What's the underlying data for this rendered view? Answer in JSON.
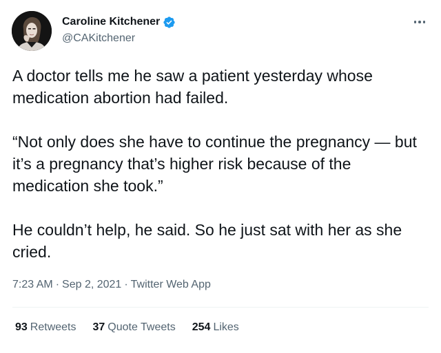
{
  "author": {
    "name": "Caroline Kitchener",
    "handle": "@CAKitchener",
    "verified": true,
    "verified_color": "#1d9bf0"
  },
  "icons": {
    "verified": "verified-badge-icon",
    "more": "more-options-icon",
    "avatar": "profile-photo"
  },
  "tweet": {
    "paragraph_1": "A doctor tells me he saw a patient yesterday whose medication abortion had failed.",
    "paragraph_2": "“Not only does she have to continue the pregnancy — but it’s a pregnancy that’s higher risk because of the medication she took.”",
    "paragraph_3": "He couldn’t help, he said. So he just sat with her as she cried."
  },
  "meta": {
    "time": "7:23 AM",
    "separator_1": "·",
    "date": "Sep 2, 2021",
    "separator_2": "·",
    "app": "Twitter Web App"
  },
  "stats": {
    "retweets_count": "93",
    "retweets_label": "Retweets",
    "quotes_count": "37",
    "quotes_label": "Quote Tweets",
    "likes_count": "254",
    "likes_label": "Likes"
  }
}
